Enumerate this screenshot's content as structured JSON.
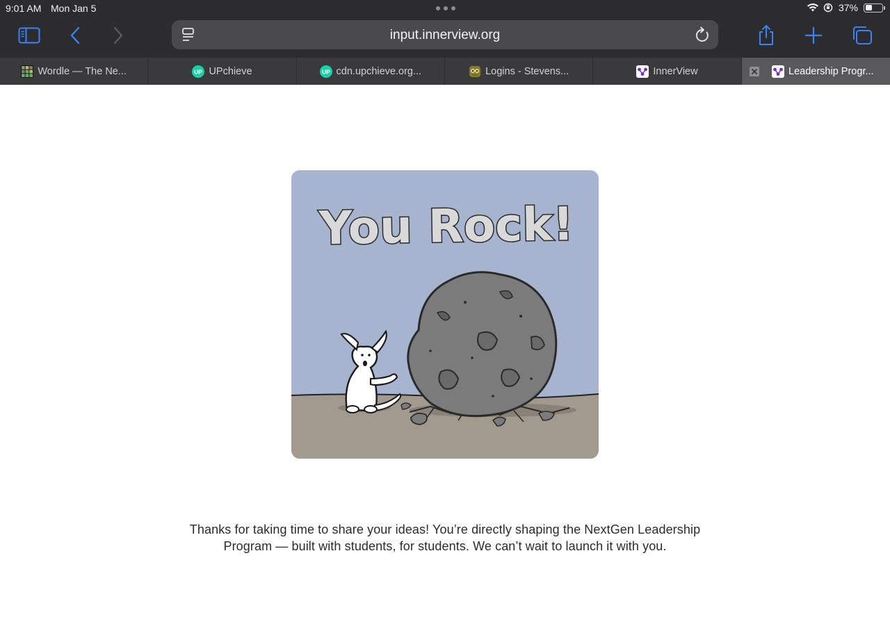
{
  "status_bar": {
    "time": "9:01 AM",
    "date": "Mon Jan 5",
    "battery_percent_text": "37%",
    "battery_level": 0.37
  },
  "address_bar": {
    "url": "input.innerview.org"
  },
  "tabs": [
    {
      "title": "Wordle — The Ne...",
      "favicon": "wordle-grid-icon",
      "active": false
    },
    {
      "title": "UPchieve",
      "favicon": "upchieve-icon",
      "favicon_text": "UP",
      "active": false
    },
    {
      "title": "cdn.upchieve.org...",
      "favicon": "upchieve-icon",
      "favicon_text": "UP",
      "active": false
    },
    {
      "title": "Logins - Stevens...",
      "favicon": "owl-icon",
      "active": false
    },
    {
      "title": "InnerView",
      "favicon": "innerview-icon",
      "active": false
    },
    {
      "title": "Leadership Progr...",
      "favicon": "innerview-icon",
      "active": true
    }
  ],
  "illustration": {
    "heading": "You Rock!"
  },
  "message": {
    "line1": "Thanks for taking  time to share your ideas! You’re directly shaping the NextGen Leadership",
    "line2": "Program — built with students, for students. We can’t wait to launch it with you."
  },
  "colors": {
    "chrome_bg": "#2c2c2e",
    "tab_bg": "#3a3a3c",
    "tab_active_bg": "#59595c",
    "accent_blue": "#3a82f7",
    "upchieve_green": "#16d2aa",
    "innerview_purple": "#7b2cbf",
    "sky": "#a7b4d0",
    "ground": "#a39a8f",
    "rock": "#7b7b7b"
  }
}
